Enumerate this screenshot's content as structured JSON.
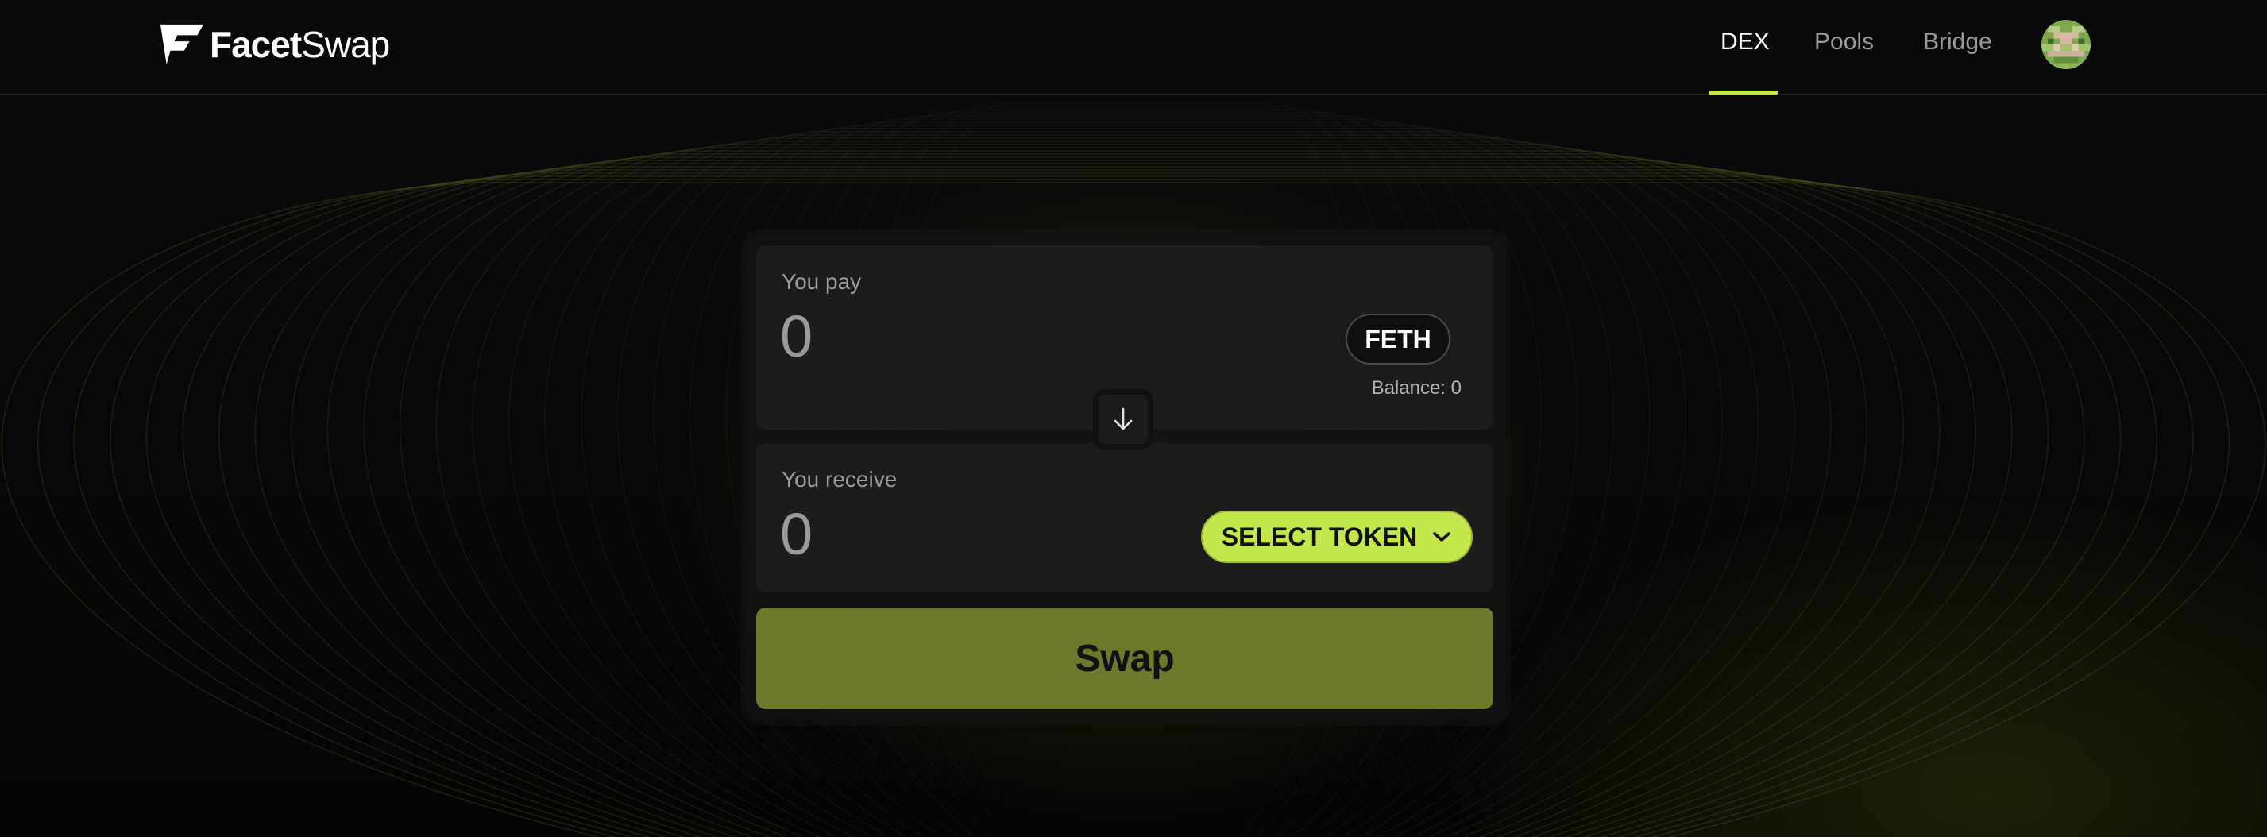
{
  "brand": {
    "name_bold": "Facet",
    "name_light": "Swap"
  },
  "nav": {
    "items": [
      {
        "label": "DEX",
        "active": true
      },
      {
        "label": "Pools",
        "active": false
      },
      {
        "label": "Bridge",
        "active": false
      }
    ]
  },
  "swap": {
    "pay": {
      "label": "You pay",
      "placeholder": "0",
      "token": "FETH",
      "balance": "Balance: 0"
    },
    "receive": {
      "label": "You receive",
      "placeholder": "0",
      "select_label": "SELECT TOKEN"
    },
    "submit_label": "Swap"
  },
  "icons": {
    "logo": "facet-logo-icon",
    "flip": "arrow-down-icon",
    "dropdown": "chevron-down-icon",
    "avatar": "pixel-avatar-icon"
  },
  "colors": {
    "accent": "#c4e84c",
    "swap_button": "#6a7a2a",
    "background": "#060606",
    "panel": "#1c1c1c"
  }
}
